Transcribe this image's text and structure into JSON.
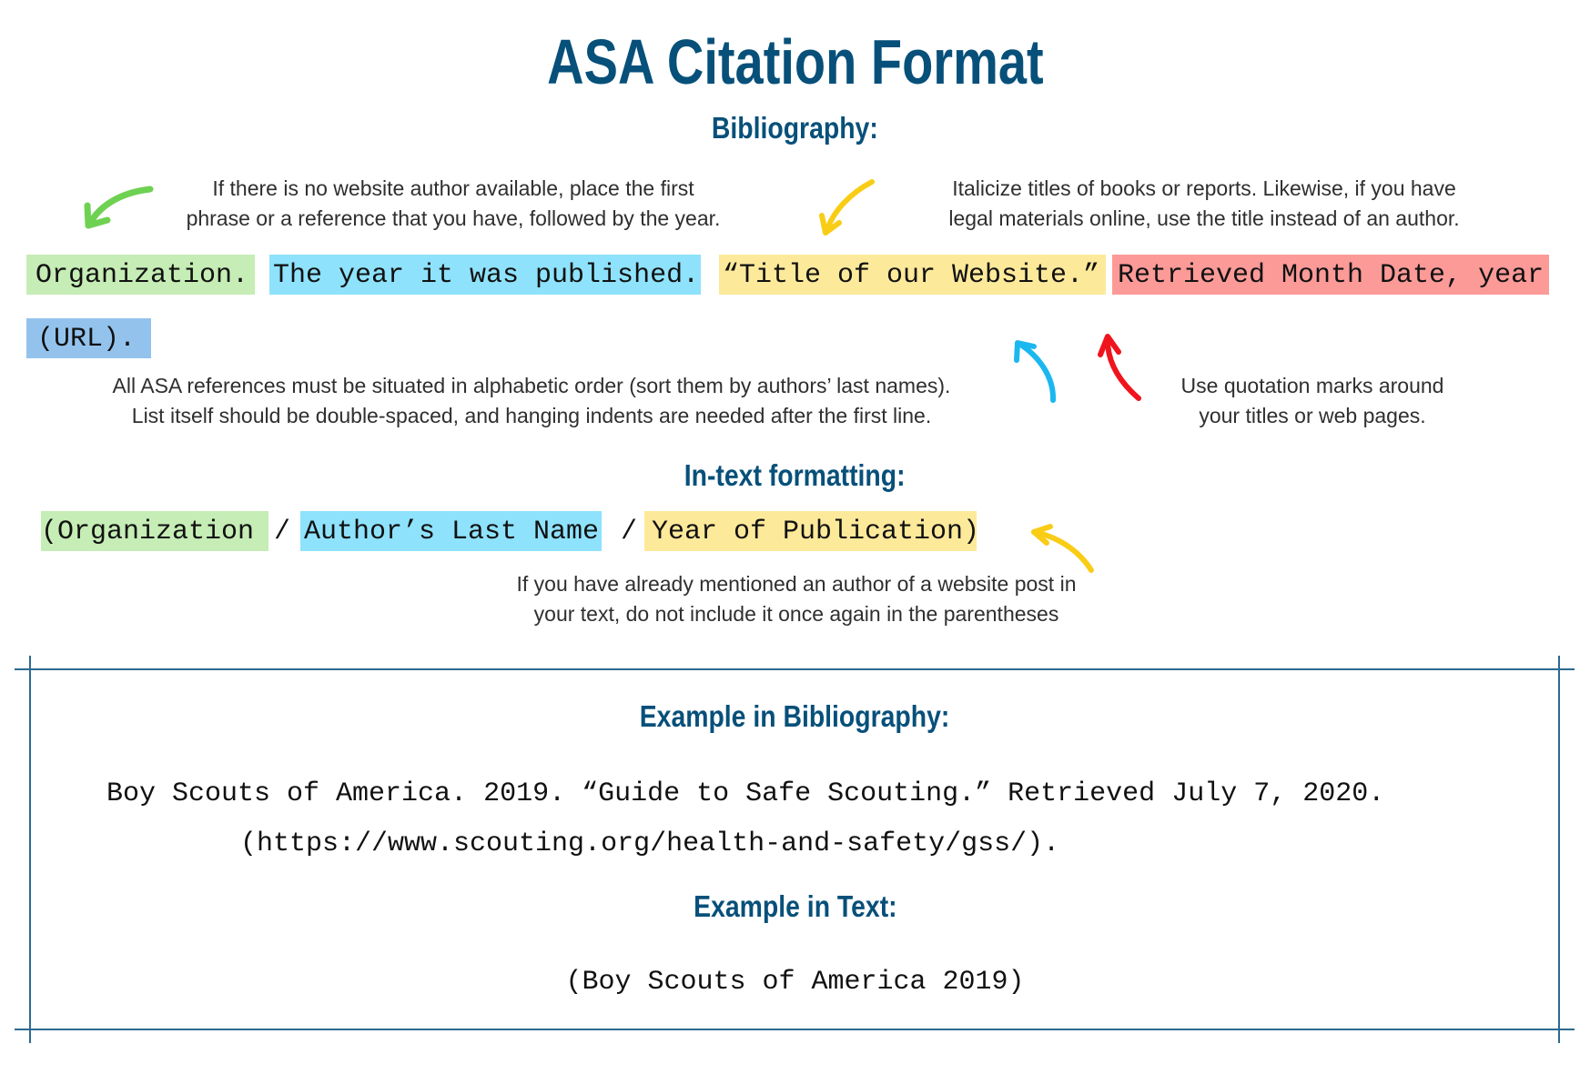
{
  "header": {
    "title": "ASA Citation Format"
  },
  "bibliography": {
    "heading": "Bibliography:",
    "note_left": [
      "If there is no website author available, place the first",
      "phrase or a reference that you have, followed by the year."
    ],
    "note_right": [
      "Italicize titles of books or reports. Likewise, if you have",
      "legal materials online, use the title instead of an author."
    ],
    "segments": [
      {
        "label": "Organization.",
        "color": "#C5EDB5"
      },
      {
        "label": "The year it was published.",
        "color": "#8EE2FC"
      },
      {
        "label": "“Title of our Website.”",
        "color": "#FDE99A"
      },
      {
        "label": "Retrieved Month Date, year",
        "color": "#FC9A98"
      },
      {
        "label": "(URL).",
        "color": "#93C3ED"
      }
    ],
    "note_order": [
      "All ASA references must be situated in alphabetic order (sort them by authors’ last names).",
      "List itself should be double-spaced, and hanging indents are needed after the first line."
    ],
    "note_quotes": [
      "Use quotation marks around",
      "your titles or web pages."
    ]
  },
  "intext": {
    "heading": "In-text formatting:",
    "segments": [
      {
        "label": "(Organization",
        "color": "#C5EDB5"
      },
      {
        "label": "Author’s Last Name",
        "color": "#8EE2FC"
      },
      {
        "label": "Year of Publication)",
        "color": "#FDE99A"
      }
    ],
    "separator": "/",
    "note": [
      "If you have already mentioned an author of a website post in",
      "your text, do not include it once again in the parentheses"
    ]
  },
  "examples": {
    "bib_heading": "Example in Bibliography:",
    "bib_lines": [
      "Boy Scouts of America. 2019. “Guide to Safe Scouting.” Retrieved July 7, 2020.",
      "(https://www.scouting.org/health-and-safety/gss/)."
    ],
    "text_heading": "Example in Text:",
    "text_example": "(Boy Scouts of America 2019)"
  },
  "colors": {
    "heading": "#07507A",
    "frame": "#2B6A90",
    "arrow_green": "#6FD152",
    "arrow_yellow": "#F9CC16",
    "arrow_blue": "#1BB8F0",
    "arrow_red": "#F0141C"
  },
  "icons": [
    "arrow-green-icon",
    "arrow-yellow-icon",
    "arrow-blue-icon",
    "arrow-red-icon",
    "arrow-yellow-intext-icon"
  ]
}
